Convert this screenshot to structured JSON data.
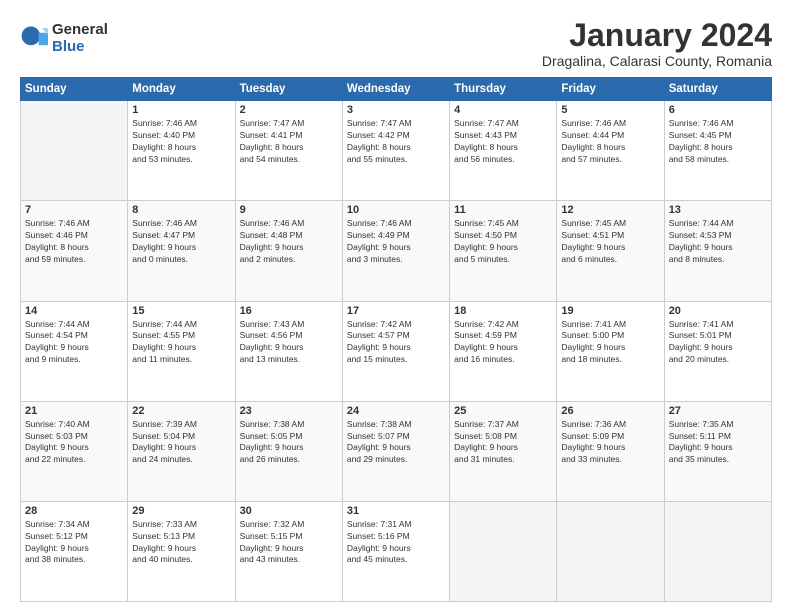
{
  "logo": {
    "general": "General",
    "blue": "Blue"
  },
  "title": "January 2024",
  "subtitle": "Dragalina, Calarasi County, Romania",
  "calendar": {
    "headers": [
      "Sunday",
      "Monday",
      "Tuesday",
      "Wednesday",
      "Thursday",
      "Friday",
      "Saturday"
    ],
    "rows": [
      [
        {
          "day": "",
          "info": ""
        },
        {
          "day": "1",
          "info": "Sunrise: 7:46 AM\nSunset: 4:40 PM\nDaylight: 8 hours\nand 53 minutes."
        },
        {
          "day": "2",
          "info": "Sunrise: 7:47 AM\nSunset: 4:41 PM\nDaylight: 8 hours\nand 54 minutes."
        },
        {
          "day": "3",
          "info": "Sunrise: 7:47 AM\nSunset: 4:42 PM\nDaylight: 8 hours\nand 55 minutes."
        },
        {
          "day": "4",
          "info": "Sunrise: 7:47 AM\nSunset: 4:43 PM\nDaylight: 8 hours\nand 56 minutes."
        },
        {
          "day": "5",
          "info": "Sunrise: 7:46 AM\nSunset: 4:44 PM\nDaylight: 8 hours\nand 57 minutes."
        },
        {
          "day": "6",
          "info": "Sunrise: 7:46 AM\nSunset: 4:45 PM\nDaylight: 8 hours\nand 58 minutes."
        }
      ],
      [
        {
          "day": "7",
          "info": "Sunrise: 7:46 AM\nSunset: 4:46 PM\nDaylight: 8 hours\nand 59 minutes."
        },
        {
          "day": "8",
          "info": "Sunrise: 7:46 AM\nSunset: 4:47 PM\nDaylight: 9 hours\nand 0 minutes."
        },
        {
          "day": "9",
          "info": "Sunrise: 7:46 AM\nSunset: 4:48 PM\nDaylight: 9 hours\nand 2 minutes."
        },
        {
          "day": "10",
          "info": "Sunrise: 7:46 AM\nSunset: 4:49 PM\nDaylight: 9 hours\nand 3 minutes."
        },
        {
          "day": "11",
          "info": "Sunrise: 7:45 AM\nSunset: 4:50 PM\nDaylight: 9 hours\nand 5 minutes."
        },
        {
          "day": "12",
          "info": "Sunrise: 7:45 AM\nSunset: 4:51 PM\nDaylight: 9 hours\nand 6 minutes."
        },
        {
          "day": "13",
          "info": "Sunrise: 7:44 AM\nSunset: 4:53 PM\nDaylight: 9 hours\nand 8 minutes."
        }
      ],
      [
        {
          "day": "14",
          "info": "Sunrise: 7:44 AM\nSunset: 4:54 PM\nDaylight: 9 hours\nand 9 minutes."
        },
        {
          "day": "15",
          "info": "Sunrise: 7:44 AM\nSunset: 4:55 PM\nDaylight: 9 hours\nand 11 minutes."
        },
        {
          "day": "16",
          "info": "Sunrise: 7:43 AM\nSunset: 4:56 PM\nDaylight: 9 hours\nand 13 minutes."
        },
        {
          "day": "17",
          "info": "Sunrise: 7:42 AM\nSunset: 4:57 PM\nDaylight: 9 hours\nand 15 minutes."
        },
        {
          "day": "18",
          "info": "Sunrise: 7:42 AM\nSunset: 4:59 PM\nDaylight: 9 hours\nand 16 minutes."
        },
        {
          "day": "19",
          "info": "Sunrise: 7:41 AM\nSunset: 5:00 PM\nDaylight: 9 hours\nand 18 minutes."
        },
        {
          "day": "20",
          "info": "Sunrise: 7:41 AM\nSunset: 5:01 PM\nDaylight: 9 hours\nand 20 minutes."
        }
      ],
      [
        {
          "day": "21",
          "info": "Sunrise: 7:40 AM\nSunset: 5:03 PM\nDaylight: 9 hours\nand 22 minutes."
        },
        {
          "day": "22",
          "info": "Sunrise: 7:39 AM\nSunset: 5:04 PM\nDaylight: 9 hours\nand 24 minutes."
        },
        {
          "day": "23",
          "info": "Sunrise: 7:38 AM\nSunset: 5:05 PM\nDaylight: 9 hours\nand 26 minutes."
        },
        {
          "day": "24",
          "info": "Sunrise: 7:38 AM\nSunset: 5:07 PM\nDaylight: 9 hours\nand 29 minutes."
        },
        {
          "day": "25",
          "info": "Sunrise: 7:37 AM\nSunset: 5:08 PM\nDaylight: 9 hours\nand 31 minutes."
        },
        {
          "day": "26",
          "info": "Sunrise: 7:36 AM\nSunset: 5:09 PM\nDaylight: 9 hours\nand 33 minutes."
        },
        {
          "day": "27",
          "info": "Sunrise: 7:35 AM\nSunset: 5:11 PM\nDaylight: 9 hours\nand 35 minutes."
        }
      ],
      [
        {
          "day": "28",
          "info": "Sunrise: 7:34 AM\nSunset: 5:12 PM\nDaylight: 9 hours\nand 38 minutes."
        },
        {
          "day": "29",
          "info": "Sunrise: 7:33 AM\nSunset: 5:13 PM\nDaylight: 9 hours\nand 40 minutes."
        },
        {
          "day": "30",
          "info": "Sunrise: 7:32 AM\nSunset: 5:15 PM\nDaylight: 9 hours\nand 43 minutes."
        },
        {
          "day": "31",
          "info": "Sunrise: 7:31 AM\nSunset: 5:16 PM\nDaylight: 9 hours\nand 45 minutes."
        },
        {
          "day": "",
          "info": ""
        },
        {
          "day": "",
          "info": ""
        },
        {
          "day": "",
          "info": ""
        }
      ]
    ]
  }
}
